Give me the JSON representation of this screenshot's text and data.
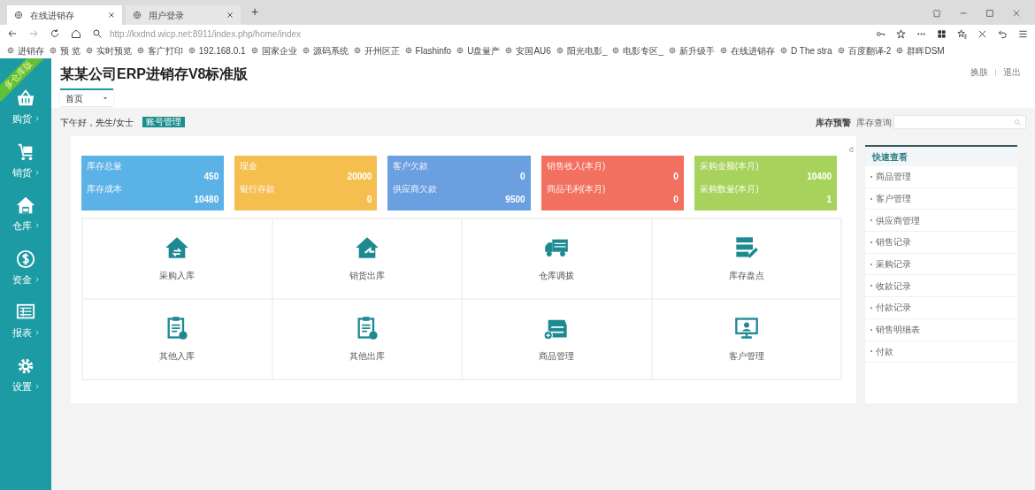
{
  "browser": {
    "tabs": [
      {
        "label": "在线进销存",
        "selected": true
      },
      {
        "label": "用户登录",
        "selected": false
      }
    ],
    "new_tab": "+",
    "url": "http://kxdnd.wicp.net:8911/index.php/home/index",
    "bookmarks": [
      "进销存",
      "预 览",
      "实时预览",
      "客广打印",
      "192.168.0.1",
      "国家企业",
      "源码系统",
      "开州区正",
      "Flashinfo",
      "U盘量产",
      "安国AU6",
      "阳光电影_",
      "电影专区_",
      "新升级手",
      "在线进销存",
      "D The stra",
      "百度翻译-2",
      "群晖DSM"
    ]
  },
  "sidebar": {
    "ribbon": "多仓库版",
    "items": [
      {
        "label": "购货"
      },
      {
        "label": "销货"
      },
      {
        "label": "仓库"
      },
      {
        "label": "资金"
      },
      {
        "label": "报表"
      },
      {
        "label": "设置"
      }
    ]
  },
  "header": {
    "title": "某某公司ERP进销存V8标准版",
    "links": [
      "换肤",
      "退出"
    ]
  },
  "page_tabs": [
    {
      "label": "首页",
      "selected": true
    }
  ],
  "greeting": "下午好，先生/女士",
  "account_button": "账号管理",
  "stock_alert": "库存预警",
  "stock_query": "库存查询",
  "stat_cards": [
    {
      "color": "#5bb2e6",
      "rows": [
        {
          "label": "库存总量",
          "value": "450"
        },
        {
          "label": "库存成本",
          "value": "10480"
        }
      ]
    },
    {
      "color": "#f5bf50",
      "rows": [
        {
          "label": "现金",
          "value": "20000"
        },
        {
          "label": "银行存款",
          "value": "0"
        }
      ]
    },
    {
      "color": "#6a9fe0",
      "rows": [
        {
          "label": "客户欠款",
          "value": "0"
        },
        {
          "label": "供应商欠款",
          "value": "9500"
        }
      ]
    },
    {
      "color": "#f2705f",
      "rows": [
        {
          "label": "销售收入(本月)",
          "value": "0"
        },
        {
          "label": "商品毛利(本月)",
          "value": "0"
        }
      ]
    },
    {
      "color": "#a7d35c",
      "rows": [
        {
          "label": "采购金额(本月)",
          "value": "10400"
        },
        {
          "label": "采购数量(本月)",
          "value": "1"
        }
      ]
    }
  ],
  "shortcuts": [
    {
      "label": "采购入库"
    },
    {
      "label": "销货出库"
    },
    {
      "label": "仓库调拨"
    },
    {
      "label": "库存盘点"
    },
    {
      "label": "其他入库"
    },
    {
      "label": "其他出库"
    },
    {
      "label": "商品管理"
    },
    {
      "label": "客户管理"
    }
  ],
  "quick_view": {
    "title": "快速查看",
    "items": [
      "商品管理",
      "客户管理",
      "供应商管理",
      "销售记录",
      "采购记录",
      "收款记录",
      "付款记录",
      "销售明细表",
      "付款"
    ]
  }
}
